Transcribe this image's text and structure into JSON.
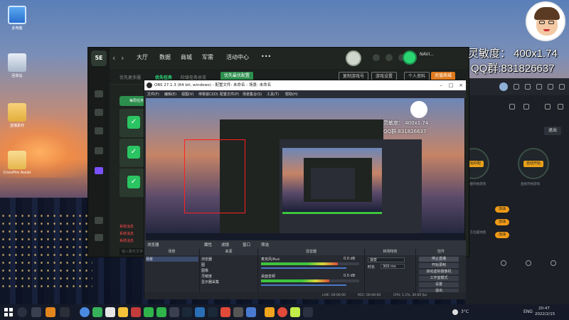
{
  "desktop": {
    "icons": [
      {
        "label": "此电脑"
      },
      {
        "label": "回收站"
      },
      {
        "label": "直播素材"
      },
      {
        "label": "CrossFire Assist"
      }
    ]
  },
  "overlay": {
    "sensitivity": "灵敏度：  400x1.74",
    "qq_group": "QQ群:831826637"
  },
  "launcher": {
    "logo": "5E",
    "nav": [
      "大厅",
      "数据",
      "商城",
      "军需",
      "活动中心",
      "•••"
    ],
    "username": "NAVI...",
    "tabs": [
      "优先更多服",
      "优先任务",
      "阶级任务总览"
    ],
    "active_tab": "优先任务",
    "highlight_button": "优先最优配置",
    "buttons": {
      "bind": "复制游戏号",
      "more": "游戏设置",
      "friend": "个人资料",
      "recharge": "充值商城"
    },
    "card_label": "每周任务",
    "red_lines": [
      "系统消息",
      "系统消息",
      "系统消息"
    ],
    "input_placeholder": "输入聊天文字..."
  },
  "rightapp": {
    "exit_label": "退出",
    "auto_label": "开始匹配",
    "auto_label2": "自动开始",
    "pill": "加油",
    "pill2": "加油",
    "pill3": "加油",
    "note1": "快捷开始游戏",
    "note2": "直接开始游戏",
    "note3": "双方位置地图"
  },
  "obs": {
    "title": "OBS 27.1.3 (64 bit, windows) - 配置文件: 未命名 - 场景: 未命名",
    "menu": [
      "文件(F)",
      "编辑(E)",
      "视图(V)",
      "停靠窗口(D)",
      "配置文件(P)",
      "场景集合(S)",
      "工具(T)",
      "帮助(H)"
    ],
    "controls": [
      "属性",
      "滤镜",
      "窗口",
      "筛选"
    ],
    "docks": {
      "scenes": {
        "title": "场景",
        "items": [
          "场景"
        ]
      },
      "sources": {
        "title": "来源",
        "items": [
          "浏览器",
          "图",
          "图像",
          "灵敏度",
          "显示器采集"
        ]
      },
      "mixer": {
        "title": "混音器",
        "channels": [
          {
            "name": "麦克风/Aux",
            "db": "0.0 dB"
          },
          {
            "name": "桌面音频",
            "db": "0.0 dB"
          }
        ]
      },
      "transitions": {
        "title": "转场特效",
        "type": "渐变",
        "duration_label": "时长",
        "duration": "300 ms"
      },
      "controls": {
        "title": "控件",
        "buttons": [
          "停止直播",
          "开始录制",
          "启动虚拟摄像机",
          "工作室模式",
          "设置",
          "退出"
        ]
      }
    },
    "status": {
      "live": "LIVE: 00:00:00",
      "rec": "REC: 00:00:00",
      "cpu": "CPU: 1.1%, 30.00 fps"
    },
    "dock_footer_sources": "+  −  ⚙  ∧  ∨",
    "dock_footer_scenes": "+  −  ∧  ∨"
  },
  "taskbar": {
    "weather": "3°C",
    "lang": "ENG",
    "time": "20:47",
    "date": "2022/2/15"
  }
}
